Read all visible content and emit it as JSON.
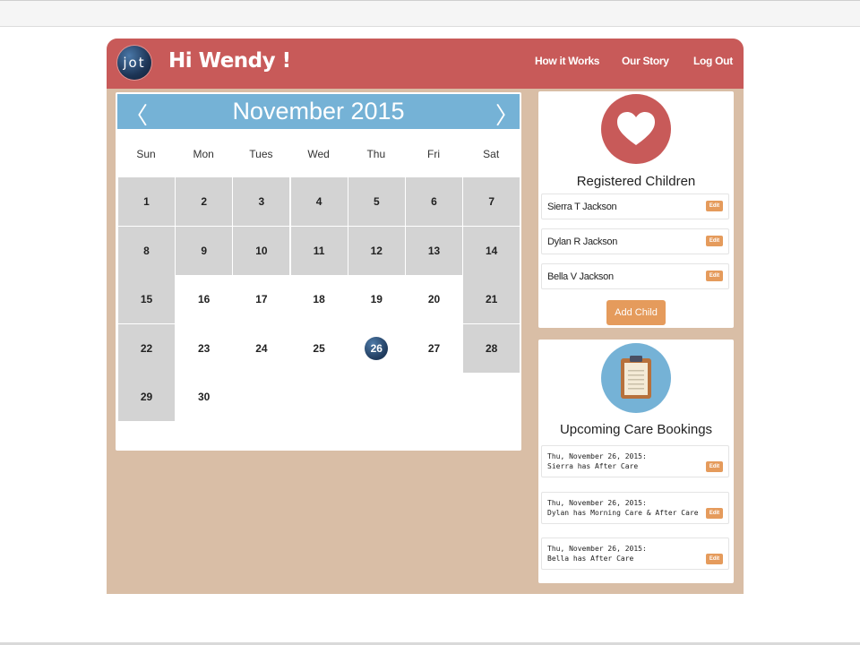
{
  "header": {
    "logo_text": "jot",
    "greeting": "Hi Wendy !",
    "nav": [
      "How it Works",
      "Our Story",
      "Log Out"
    ]
  },
  "calendar": {
    "prev_icon": "chevron-left-icon",
    "next_icon": "chevron-right-icon",
    "prev_symbol": "〈",
    "next_symbol": "〉",
    "title": "November 2015",
    "weekdays": [
      "Sun",
      "Mon",
      "Tues",
      "Wed",
      "Thu",
      "Fri",
      "Sat"
    ],
    "days": [
      "1",
      "2",
      "3",
      "4",
      "5",
      "6",
      "7",
      "8",
      "9",
      "10",
      "11",
      "12",
      "13",
      "14",
      "15",
      "16",
      "17",
      "18",
      "19",
      "20",
      "21",
      "22",
      "23",
      "24",
      "25",
      "26",
      "27",
      "28",
      "29",
      "30"
    ],
    "selected_day": "26"
  },
  "children_panel": {
    "icon": "heart-icon",
    "title": "Registered Children",
    "children": [
      "Sierra T Jackson",
      "Dylan R Jackson",
      "Bella V Jackson"
    ],
    "edit_label": "Edit",
    "add_label": "Add Child"
  },
  "bookings_panel": {
    "icon": "clipboard-icon",
    "title": "Upcoming Care Bookings",
    "bookings": [
      {
        "date": "Thu, November 26, 2015:",
        "detail": "Sierra has After Care"
      },
      {
        "date": "Thu, November 26, 2015:",
        "detail": "Dylan has Morning Care & After Care"
      },
      {
        "date": "Thu, November 26, 2015:",
        "detail": "Bella has After Care"
      }
    ],
    "edit_label": "Edit"
  },
  "colors": {
    "header": "#c85a59",
    "background": "#d9bea6",
    "calendar_header": "#75b2d6",
    "button": "#e59b5c",
    "weekend_cell": "#d3d3d3"
  }
}
